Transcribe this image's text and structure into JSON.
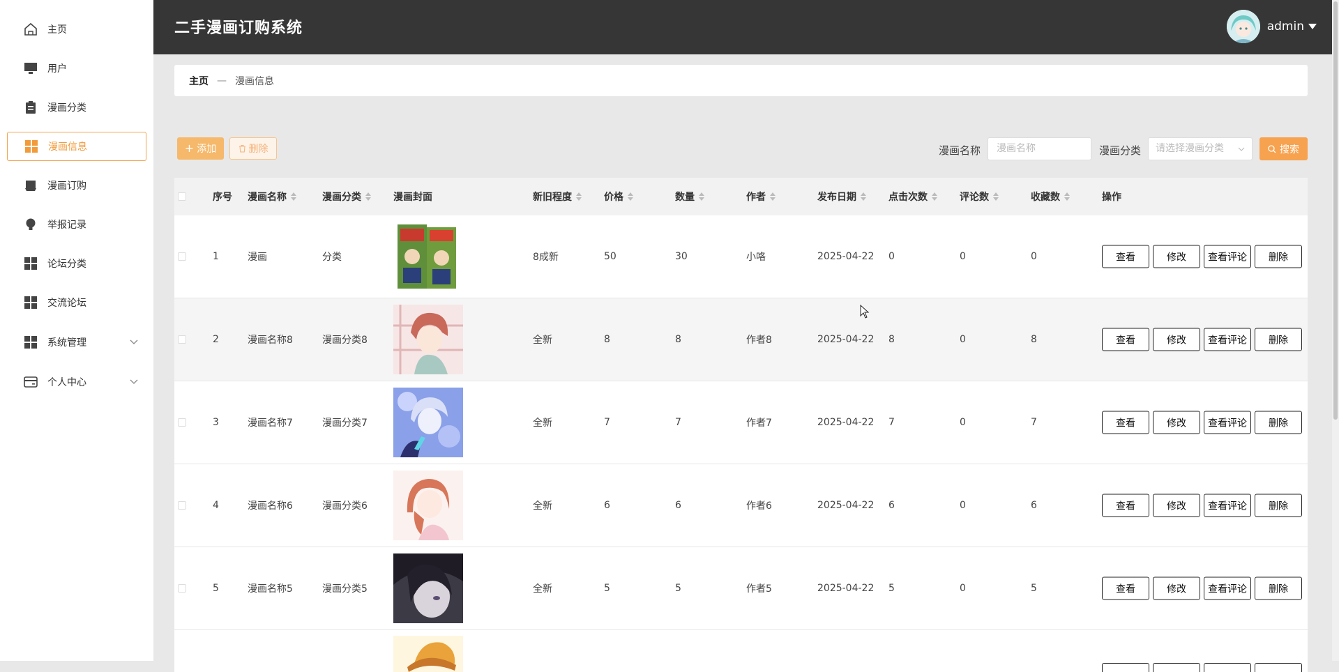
{
  "sidebar": {
    "items": [
      {
        "label": "主页"
      },
      {
        "label": "用户"
      },
      {
        "label": "漫画分类"
      },
      {
        "label": "漫画信息"
      },
      {
        "label": "漫画订购"
      },
      {
        "label": "举报记录"
      },
      {
        "label": "论坛分类"
      },
      {
        "label": "交流论坛"
      },
      {
        "label": "系统管理"
      },
      {
        "label": "个人中心"
      }
    ],
    "active_index": 3
  },
  "header": {
    "title": "二手漫画订购系统",
    "user_name": "admin"
  },
  "breadcrumb": {
    "home": "主页",
    "separator": "—",
    "current": "漫画信息"
  },
  "toolbar": {
    "add_label": "添加",
    "delete_label": "删除",
    "name_label": "漫画名称",
    "name_placeholder": "漫画名称",
    "category_label": "漫画分类",
    "category_placeholder": "请选择漫画分类",
    "search_label": "搜索"
  },
  "table": {
    "headers": {
      "index": "序号",
      "name": "漫画名称",
      "category": "漫画分类",
      "cover": "漫画封面",
      "condition": "新旧程度",
      "price": "价格",
      "quantity": "数量",
      "author": "作者",
      "date": "发布日期",
      "clicks": "点击次数",
      "comments": "评论数",
      "favorites": "收藏数",
      "actions": "操作"
    },
    "action_labels": {
      "view": "查看",
      "edit": "修改",
      "view_comments": "查看评论",
      "delete": "删除"
    },
    "rows": [
      {
        "index": "1",
        "name": "漫画",
        "category": "分类",
        "condition": "8成新",
        "price": "50",
        "quantity": "30",
        "author": "小咯",
        "date": "2025-04-22",
        "clicks": "0",
        "comments": "0",
        "favorites": "0"
      },
      {
        "index": "2",
        "name": "漫画名称8",
        "category": "漫画分类8",
        "condition": "全新",
        "price": "8",
        "quantity": "8",
        "author": "作者8",
        "date": "2025-04-22",
        "clicks": "8",
        "comments": "0",
        "favorites": "8"
      },
      {
        "index": "3",
        "name": "漫画名称7",
        "category": "漫画分类7",
        "condition": "全新",
        "price": "7",
        "quantity": "7",
        "author": "作者7",
        "date": "2025-04-22",
        "clicks": "7",
        "comments": "0",
        "favorites": "7"
      },
      {
        "index": "4",
        "name": "漫画名称6",
        "category": "漫画分类6",
        "condition": "全新",
        "price": "6",
        "quantity": "6",
        "author": "作者6",
        "date": "2025-04-22",
        "clicks": "6",
        "comments": "0",
        "favorites": "6"
      },
      {
        "index": "5",
        "name": "漫画名称5",
        "category": "漫画分类5",
        "condition": "全新",
        "price": "5",
        "quantity": "5",
        "author": "作者5",
        "date": "2025-04-22",
        "clicks": "5",
        "comments": "0",
        "favorites": "5"
      }
    ]
  },
  "colors": {
    "accent": "#f29b3b",
    "header_bg": "#363636"
  }
}
